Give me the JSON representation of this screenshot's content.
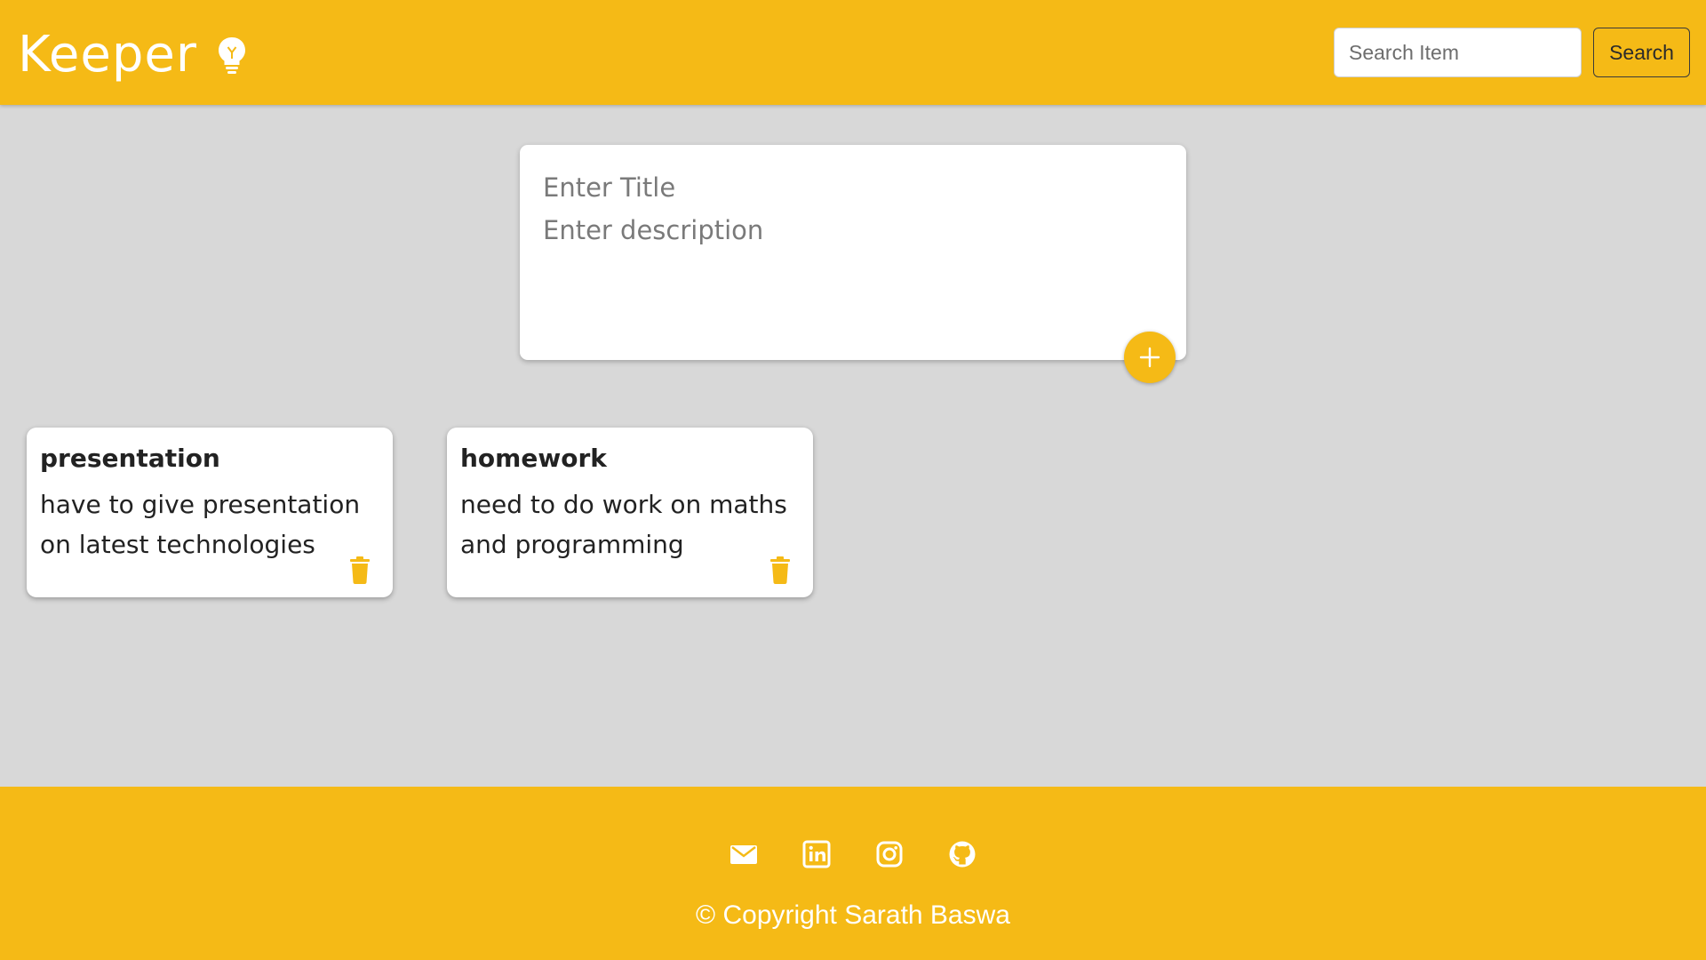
{
  "app": {
    "brand": "Keeper",
    "brand_color": "#f5ba16",
    "icon": "lightbulb-icon"
  },
  "search": {
    "placeholder": "Search Item",
    "value": "",
    "button_label": "Search"
  },
  "create_note": {
    "title_placeholder": "Enter Title",
    "description_placeholder": "Enter description",
    "add_icon": "plus-icon"
  },
  "notes": [
    {
      "title": "presentation",
      "content": "have to give presentation on latest technologies",
      "delete_icon": "trash-icon"
    },
    {
      "title": "homework",
      "content": "need to do work on maths and programming",
      "delete_icon": "trash-icon"
    }
  ],
  "footer": {
    "social_icons": [
      "mail-icon",
      "linkedin-icon",
      "instagram-icon",
      "github-icon"
    ],
    "copyright": "© Copyright Sarath Baswa"
  }
}
